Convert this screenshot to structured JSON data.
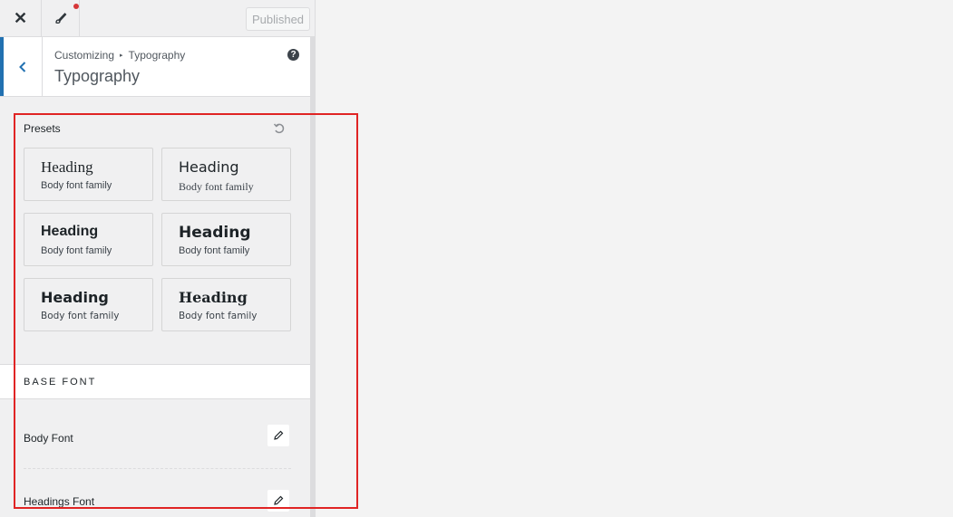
{
  "topbar": {
    "close_label": "✕",
    "published_label": "Published"
  },
  "header": {
    "breadcrumb_root": "Customizing",
    "breadcrumb_separator": "▸",
    "breadcrumb_current": "Typography",
    "title": "Typography",
    "help_label": "?"
  },
  "presets": {
    "title": "Presets",
    "items": [
      {
        "heading": "Heading",
        "body": "Body font family"
      },
      {
        "heading": "Heading",
        "body": "Body font family"
      },
      {
        "heading": "Heading",
        "body": "Body font family"
      },
      {
        "heading": "Heading",
        "body": "Body font family"
      },
      {
        "heading": "Heading",
        "body": "Body font family"
      },
      {
        "heading": "Heading",
        "body": "Body font family"
      }
    ]
  },
  "base_font": {
    "section_label": "BASE FONT",
    "body_font_label": "Body Font",
    "headings_font_label": "Headings Font"
  },
  "colors": {
    "accent": "#2271b1",
    "notification_dot": "#d63638",
    "highlight_box": "#e02424"
  },
  "icons": {
    "close": "close-icon",
    "customize": "paintbrush-icon",
    "back": "chevron-left-icon",
    "help": "help-icon",
    "reset": "reset-icon",
    "edit": "pencil-icon"
  }
}
